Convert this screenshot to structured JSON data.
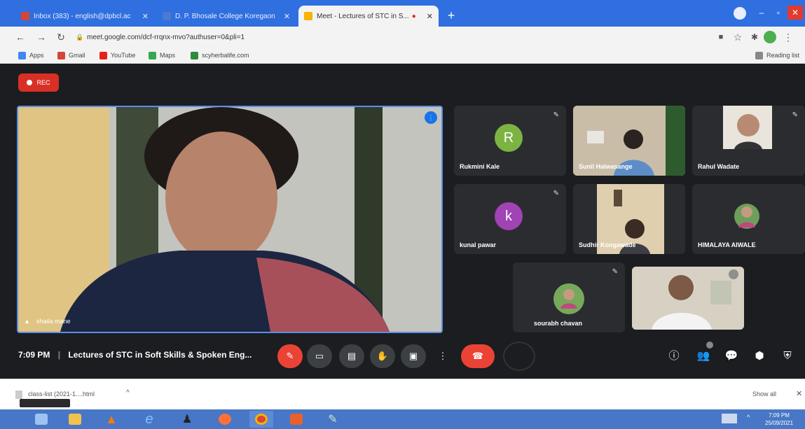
{
  "browser": {
    "tabs": [
      {
        "title": "Inbox (383) - english@dpbcl.ac",
        "favicon_color": "#d44638"
      },
      {
        "title": "D. P. Bhosale College Koregaon",
        "favicon_color": "#4a7bd0"
      },
      {
        "title": "Meet - Lectures of STC in S...",
        "favicon_color": "#f4b400"
      }
    ],
    "new_tab": "+",
    "url": "meet.google.com/dcf-rrqnx-mvo?authuser=0&pli=1",
    "bookmarks": [
      {
        "label": "Apps",
        "color": "#4285f4"
      },
      {
        "label": "Gmail",
        "color": "#d44638"
      },
      {
        "label": "YouTube",
        "color": "#e62117"
      },
      {
        "label": "Maps",
        "color": "#34a853"
      },
      {
        "label": "scyherbalife.com",
        "color": "#2e8b3c"
      }
    ],
    "reading_list": "Reading list"
  },
  "meet": {
    "rec_label": "REC",
    "main_speaker": "shaila mane",
    "participants": [
      {
        "name": "Rukmini Kale",
        "initial": "R",
        "color": "#7cb342"
      },
      {
        "name": "Sunil Halwasange",
        "initial": "",
        "color": ""
      },
      {
        "name": "Rahul Wadate",
        "initial": "",
        "color": ""
      },
      {
        "name": "kunal pawar",
        "initial": "k",
        "color": "#a142b5"
      },
      {
        "name": "Sudhir Kongawade",
        "initial": "",
        "color": ""
      },
      {
        "name": "HIMALAYA AIWALE",
        "initial": "",
        "color": ""
      },
      {
        "name": "sourabh chavan",
        "initial": "",
        "color": ""
      }
    ],
    "time": "7:09 PM",
    "meeting_title": "Lectures of STC in Soft Skills & Spoken Eng..."
  },
  "downloads": {
    "file": "class-list (2021-1....html",
    "show_all": "Show all"
  },
  "taskbar": {
    "time": "7:09 PM",
    "date": "25/09/2021"
  }
}
